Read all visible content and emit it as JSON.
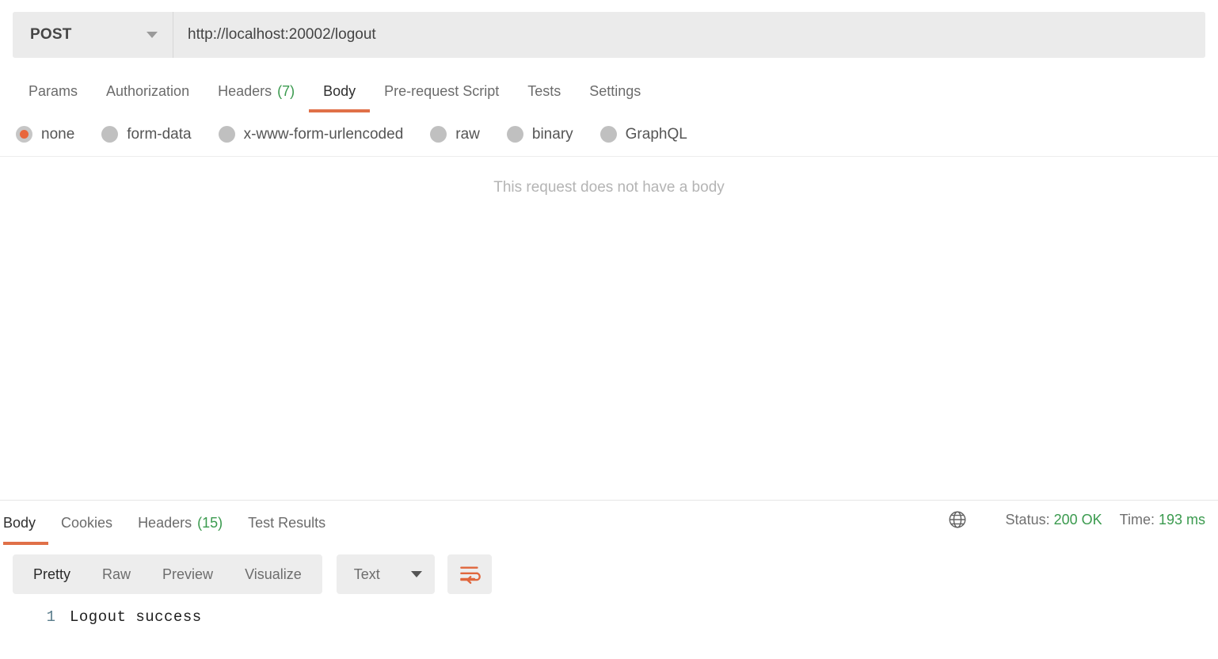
{
  "request": {
    "method": "POST",
    "url": "http://localhost:20002/logout",
    "tabs": [
      {
        "label": "Params",
        "count": "",
        "active": false
      },
      {
        "label": "Authorization",
        "count": "",
        "active": false
      },
      {
        "label": "Headers",
        "count": "(7)",
        "active": false
      },
      {
        "label": "Body",
        "count": "",
        "active": true
      },
      {
        "label": "Pre-request Script",
        "count": "",
        "active": false
      },
      {
        "label": "Tests",
        "count": "",
        "active": false
      },
      {
        "label": "Settings",
        "count": "",
        "active": false
      }
    ],
    "body_types": [
      {
        "label": "none",
        "selected": true
      },
      {
        "label": "form-data",
        "selected": false
      },
      {
        "label": "x-www-form-urlencoded",
        "selected": false
      },
      {
        "label": "raw",
        "selected": false
      },
      {
        "label": "binary",
        "selected": false
      },
      {
        "label": "GraphQL",
        "selected": false
      }
    ],
    "empty_body_message": "This request does not have a body"
  },
  "response": {
    "tabs": [
      {
        "label": "Body",
        "count": "",
        "active": true
      },
      {
        "label": "Cookies",
        "count": "",
        "active": false
      },
      {
        "label": "Headers",
        "count": "(15)",
        "active": false
      },
      {
        "label": "Test Results",
        "count": "",
        "active": false
      }
    ],
    "status_label": "Status:",
    "status_value": "200 OK",
    "time_label": "Time:",
    "time_value": "193 ms",
    "view_modes": [
      {
        "label": "Pretty",
        "active": true
      },
      {
        "label": "Raw",
        "active": false
      },
      {
        "label": "Preview",
        "active": false
      },
      {
        "label": "Visualize",
        "active": false
      }
    ],
    "format_selected": "Text",
    "lines": [
      {
        "number": "1",
        "text": "Logout success"
      }
    ]
  },
  "colors": {
    "accent": "#e07048",
    "success": "#3a9a4e",
    "field_bg": "#ebebeb",
    "muted_text": "#b4b4b4"
  }
}
